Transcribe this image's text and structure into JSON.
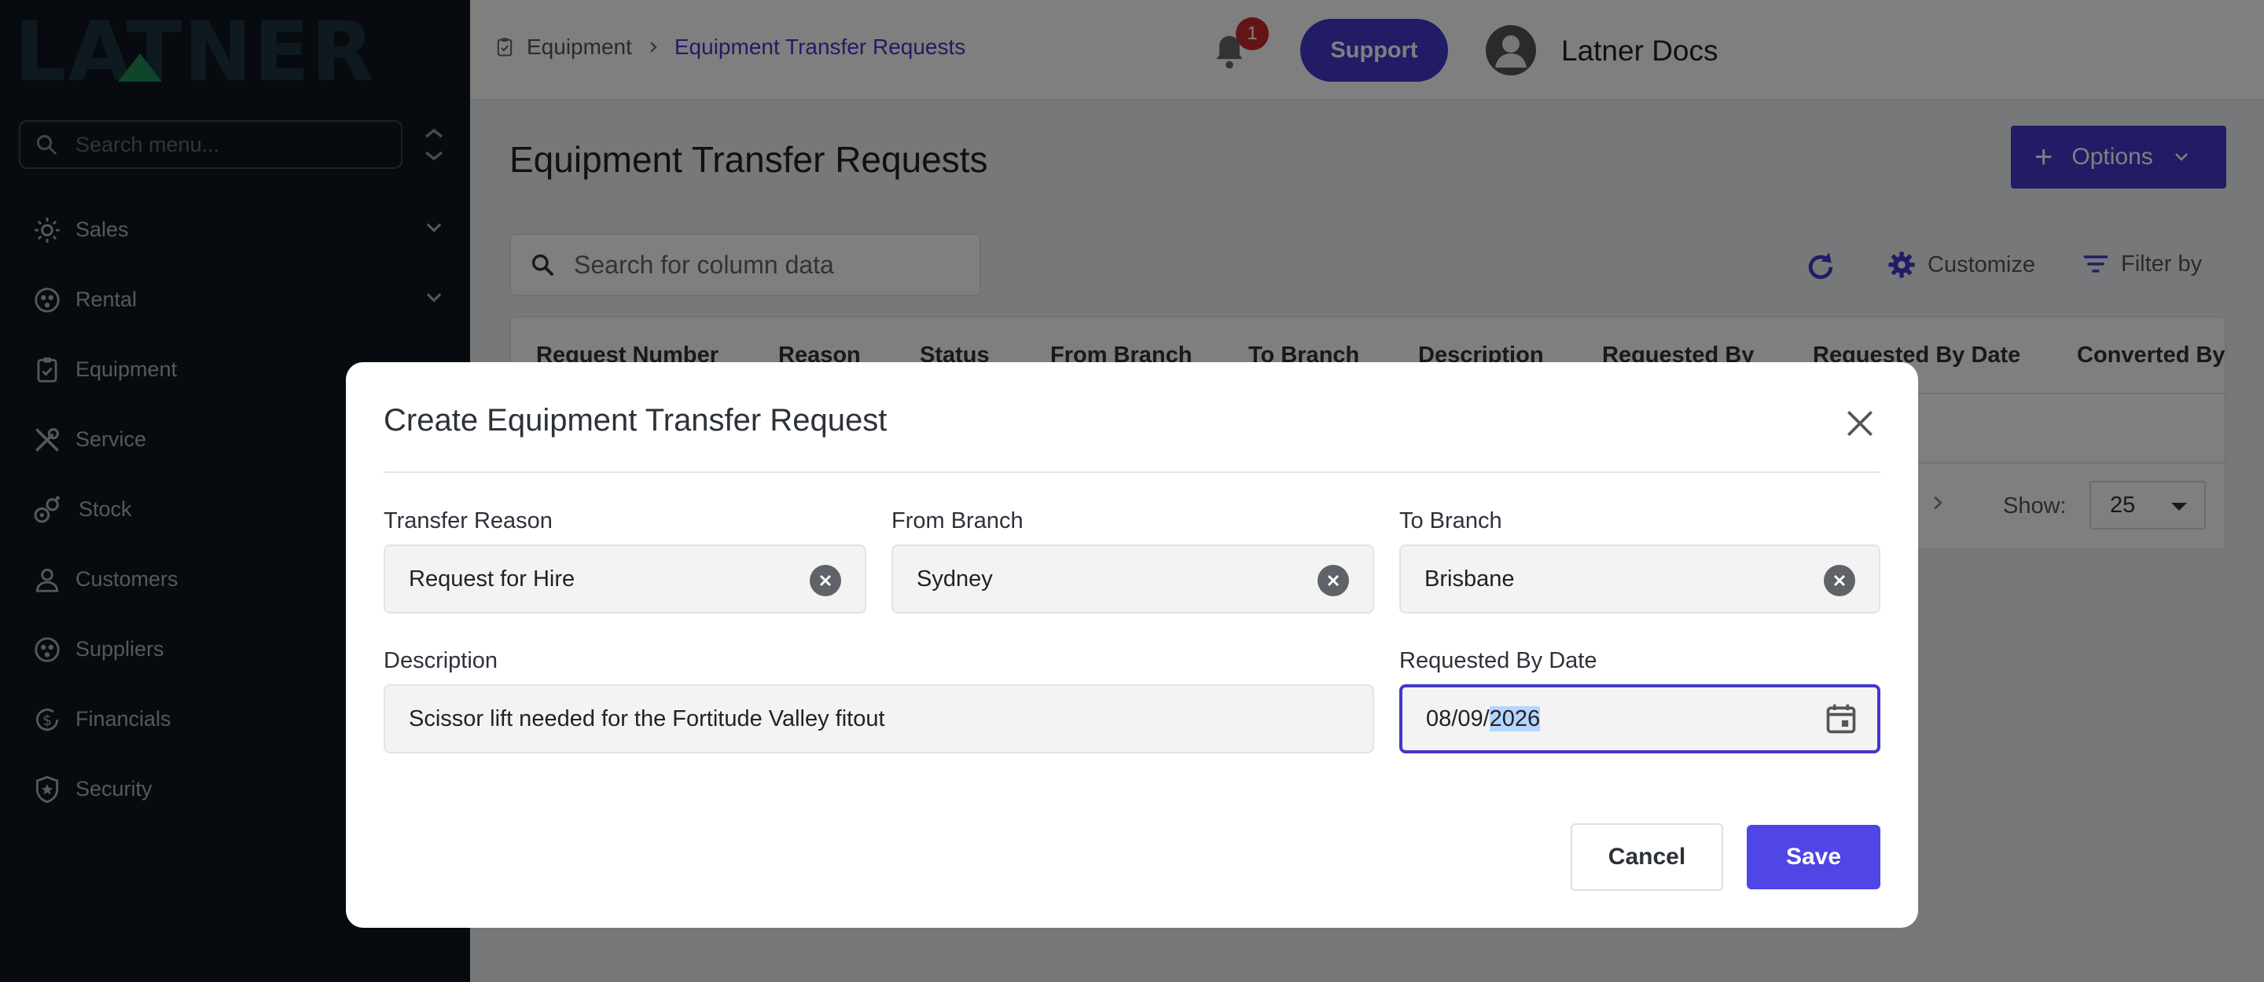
{
  "sidebar": {
    "logo_text": "LATNER",
    "search_placeholder": "Search menu...",
    "items": [
      {
        "label": "Sales",
        "icon": "sales-icon",
        "has_chevron": true
      },
      {
        "label": "Rental",
        "icon": "rental-icon",
        "has_chevron": true
      },
      {
        "label": "Equipment",
        "icon": "clipboard-icon",
        "has_chevron": false
      },
      {
        "label": "Service",
        "icon": "tools-icon",
        "has_chevron": false
      },
      {
        "label": "Stock",
        "icon": "stock-icon",
        "has_chevron": false
      },
      {
        "label": "Customers",
        "icon": "person-icon",
        "has_chevron": false
      },
      {
        "label": "Suppliers",
        "icon": "suppliers-icon",
        "has_chevron": false
      },
      {
        "label": "Financials",
        "icon": "dollar-icon",
        "has_chevron": false
      },
      {
        "label": "Security",
        "icon": "shield-icon",
        "has_chevron": false
      }
    ]
  },
  "topbar": {
    "breadcrumb": [
      "Equipment",
      "Equipment Transfer Requests"
    ],
    "notification_count": "1",
    "support_label": "Support",
    "user_name": "Latner Docs"
  },
  "page": {
    "title": "Equipment Transfer Requests",
    "options_label": "Options",
    "search_placeholder": "Search for column data",
    "customize_label": "Customize",
    "filter_label": "Filter by",
    "columns": [
      "Request Number",
      "Reason",
      "Status",
      "From Branch",
      "To Branch",
      "Description",
      "Requested By",
      "Requested By Date",
      "Converted By"
    ],
    "show_label": "Show:",
    "page_size": "25"
  },
  "modal": {
    "title": "Create Equipment Transfer Request",
    "fields": {
      "transfer_reason": {
        "label": "Transfer Reason",
        "value": "Request for Hire"
      },
      "from_branch": {
        "label": "From Branch",
        "value": "Sydney"
      },
      "to_branch": {
        "label": "To Branch",
        "value": "Brisbane"
      },
      "description": {
        "label": "Description",
        "value": "Scissor lift needed for the Fortitude Valley fitout"
      },
      "requested_by_date": {
        "label": "Requested By Date",
        "value_prefix": "08/09/",
        "value_selected": "2026"
      }
    },
    "cancel_label": "Cancel",
    "save_label": "Save"
  },
  "colors": {
    "accent": "#4338ca",
    "save_button": "#4f46e5",
    "sidebar_bg": "#0f1720",
    "badge": "#c62828"
  }
}
